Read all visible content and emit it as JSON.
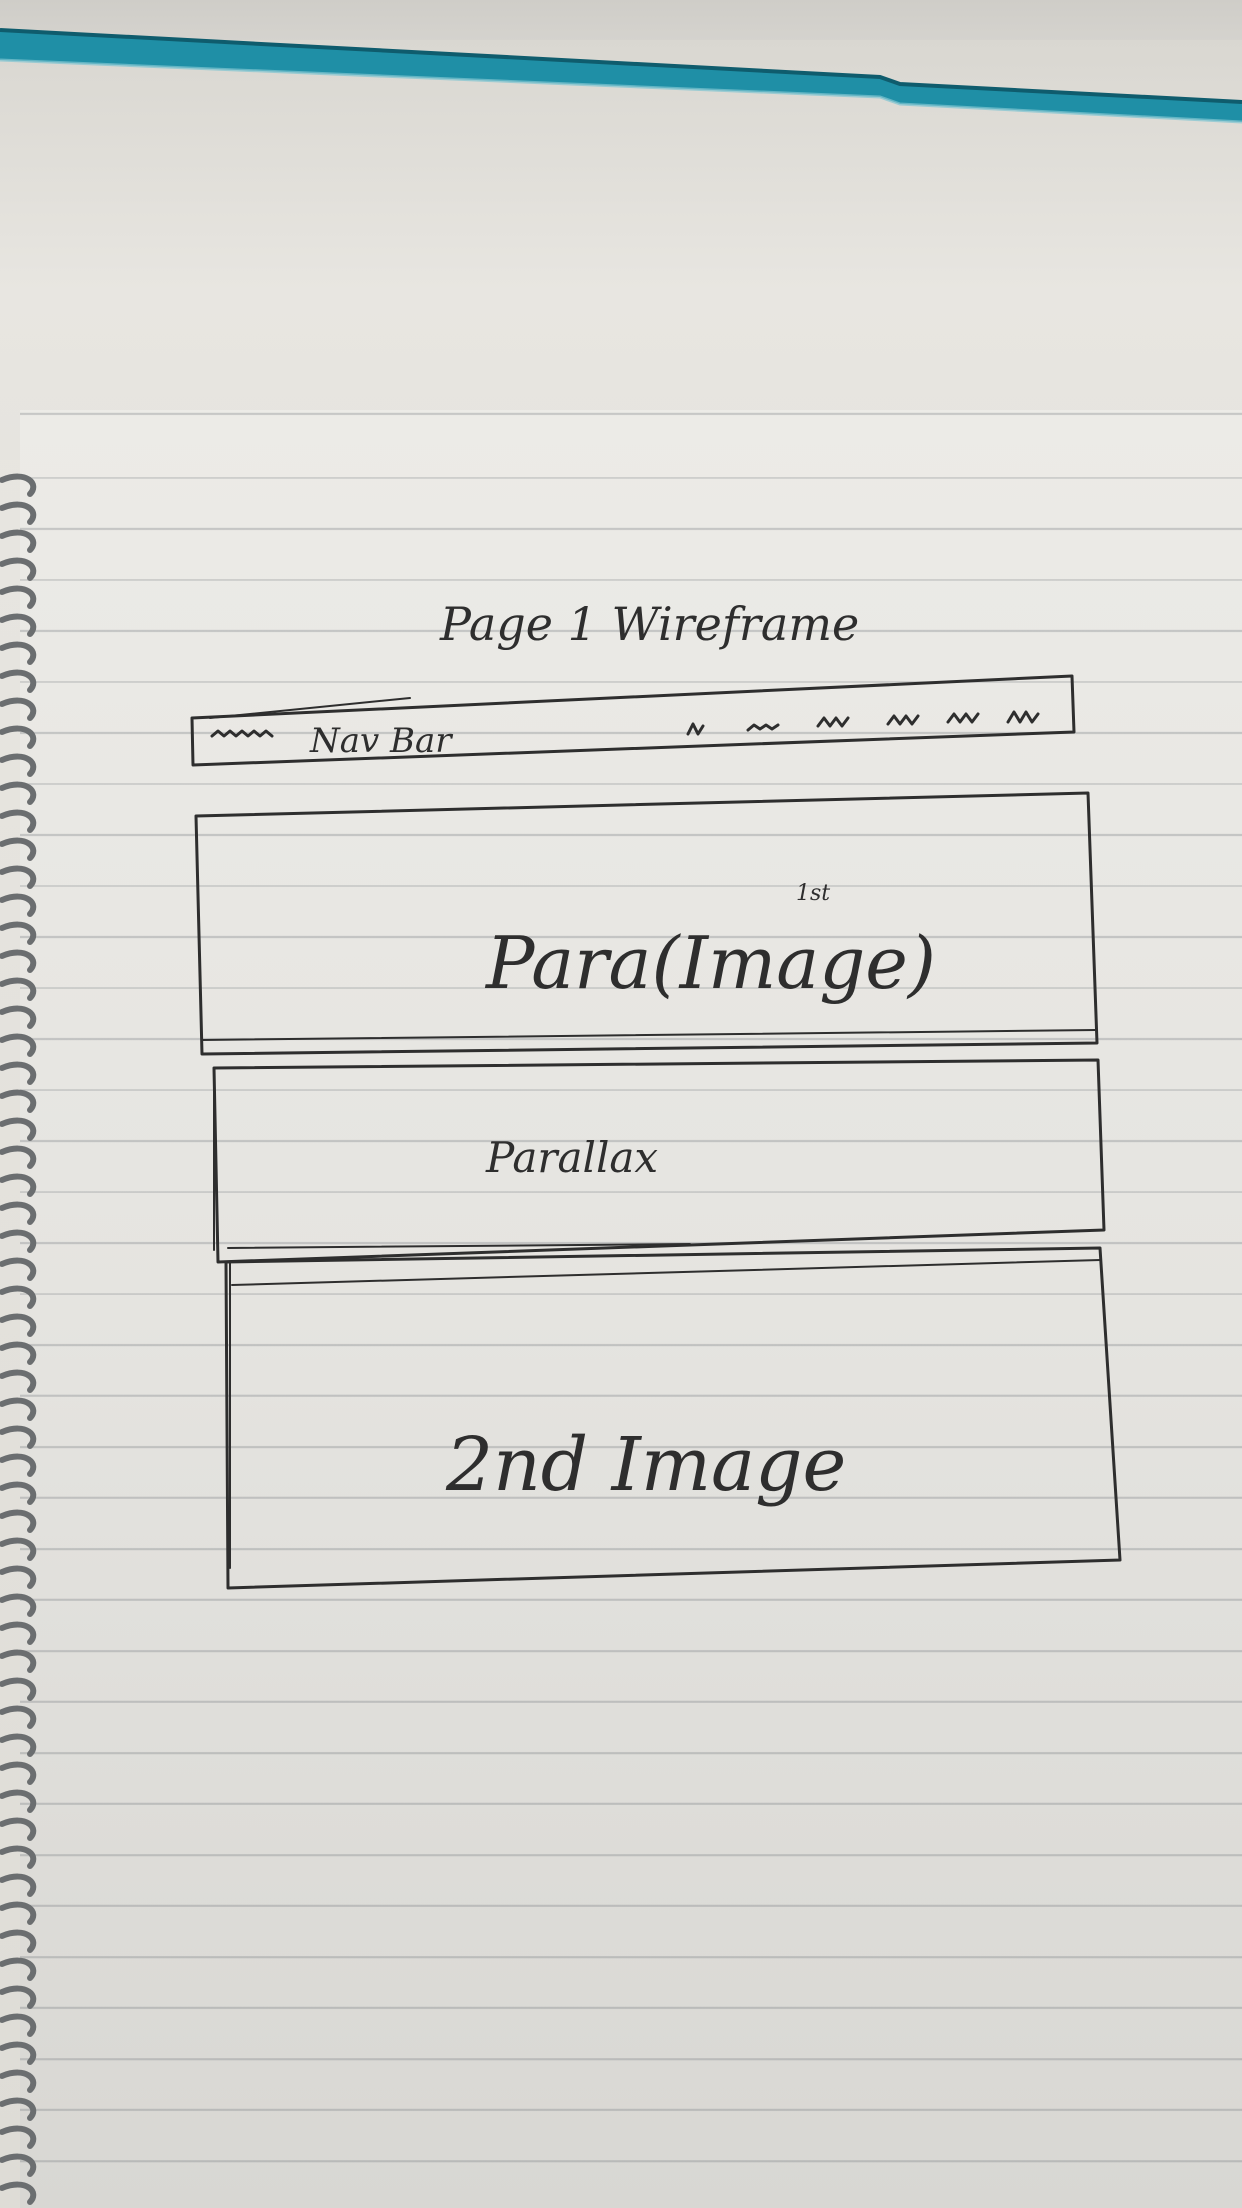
{
  "wireframe": {
    "title": "Page 1 Wireframe",
    "nav_label": "Nav Bar",
    "section1_label": "Para(Image)",
    "section1_note": "1st",
    "section2_label": "Parallax",
    "section3_label": "2nd Image"
  },
  "colors": {
    "ink": "#2e2e2e",
    "binder_teal": "#1f8fa6",
    "paper": "#ecebe7",
    "rule_line": "#8a9096"
  }
}
